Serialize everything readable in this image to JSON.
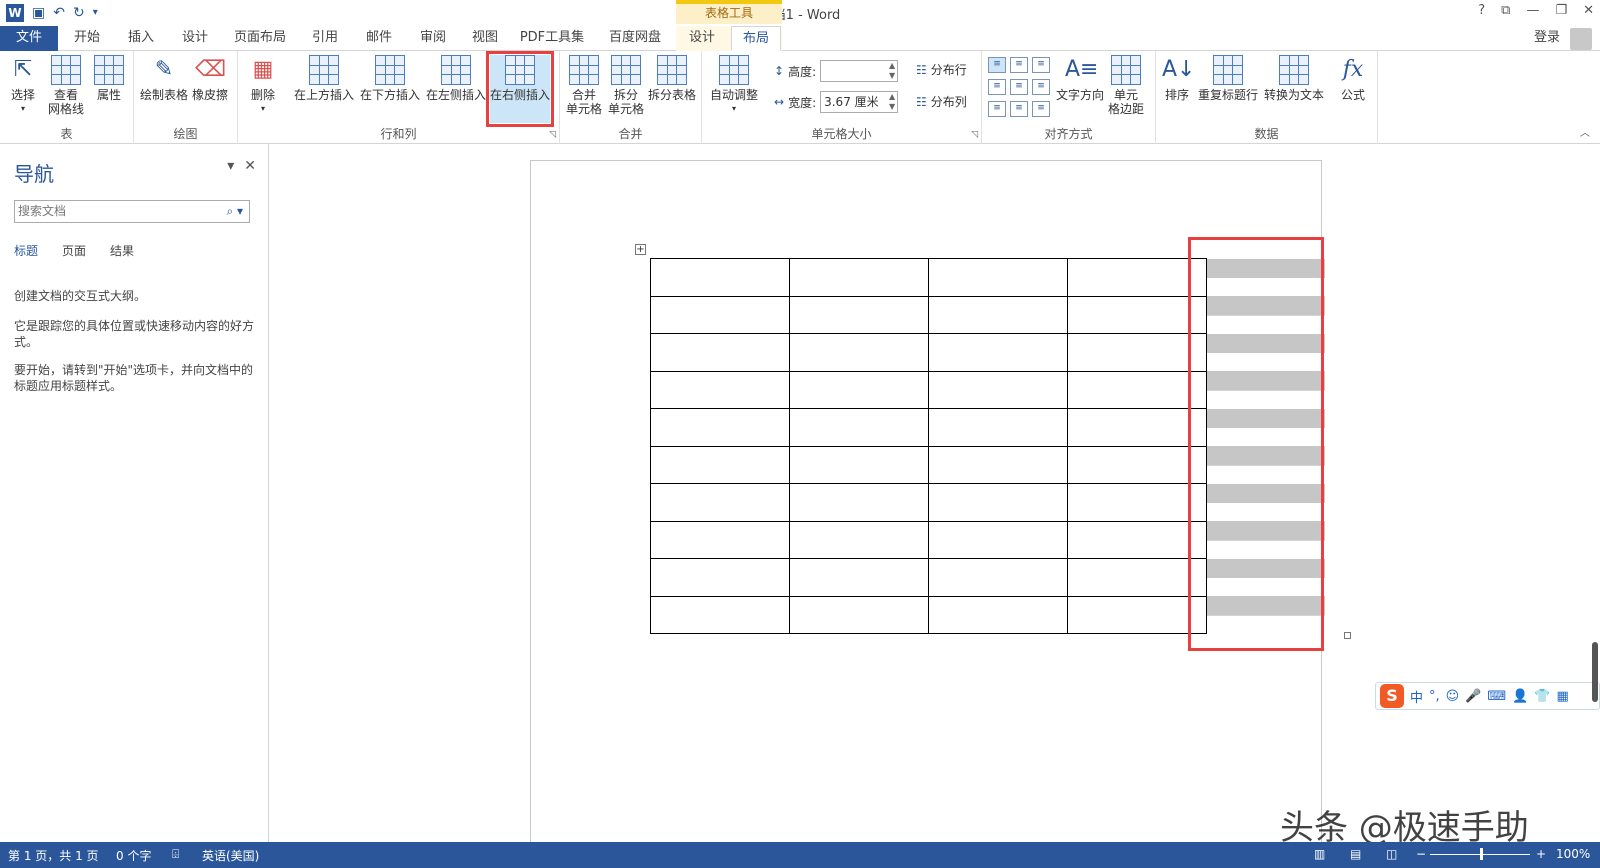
{
  "window": {
    "title": "文档1 - Word",
    "contextual_group": "表格工具",
    "controls": [
      "?",
      "⧉",
      "—",
      "❐",
      "✕"
    ]
  },
  "tabs": {
    "file": "文件",
    "items": [
      "开始",
      "插入",
      "设计",
      "页面布局",
      "引用",
      "邮件",
      "审阅",
      "视图",
      "PDF工具集",
      "百度网盘",
      "设计",
      "布局"
    ],
    "active": "布局",
    "login": "登录"
  },
  "ribbon": {
    "groups": {
      "table": "表",
      "draw": "绘图",
      "rowcol": "行和列",
      "merge": "合并",
      "cellsize": "单元格大小",
      "align": "对齐方式",
      "data": "数据"
    },
    "buttons": {
      "select": "选择",
      "gridlines": "查看\n网格线",
      "properties": "属性",
      "draw_table": "绘制表格",
      "eraser": "橡皮擦",
      "delete": "删除",
      "insert_above": "在上方插入",
      "insert_below": "在下方插入",
      "insert_left": "在左侧插入",
      "insert_right": "在右侧插入",
      "merge_cells": "合并\n单元格",
      "split_cells": "拆分\n单元格",
      "split_table": "拆分表格",
      "autofit": "自动调整",
      "height_label": "高度:",
      "height_value": "",
      "width_label": "宽度:",
      "width_value": "3.67 厘米",
      "dist_rows": "分布行",
      "dist_cols": "分布列",
      "text_dir": "文字方向",
      "cell_margins": "单元\n格边距",
      "sort": "排序",
      "repeat_header": "重复标题行",
      "convert_text": "转换为文本",
      "formula": "公式"
    }
  },
  "nav": {
    "title": "导航",
    "search_placeholder": "搜索文档",
    "tabs": [
      "标题",
      "页面",
      "结果"
    ],
    "text1": "创建文档的交互式大纲。",
    "text2": "它是跟踪您的具体位置或快速移动内容的好方式。",
    "text3": "要开始，请转到\"开始\"选项卡，并向文档中的标题应用标题样式。"
  },
  "table": {
    "rows": 10,
    "cols": 4,
    "new_col_highlight": "#c6c6c6"
  },
  "ime": {
    "logo": "S",
    "items": [
      "中",
      "°,",
      "☺",
      "🎤",
      "⌨",
      "👤",
      "👕",
      "▦"
    ]
  },
  "watermark": "头条 @极速手助",
  "status": {
    "page": "第 1 页，共 1 页",
    "words": "0 个字",
    "lang": "英语(美国)",
    "zoom": "100%"
  },
  "colors": {
    "accent": "#2b579a",
    "highlight": "#e8403f",
    "contextual": "#f2c811"
  }
}
